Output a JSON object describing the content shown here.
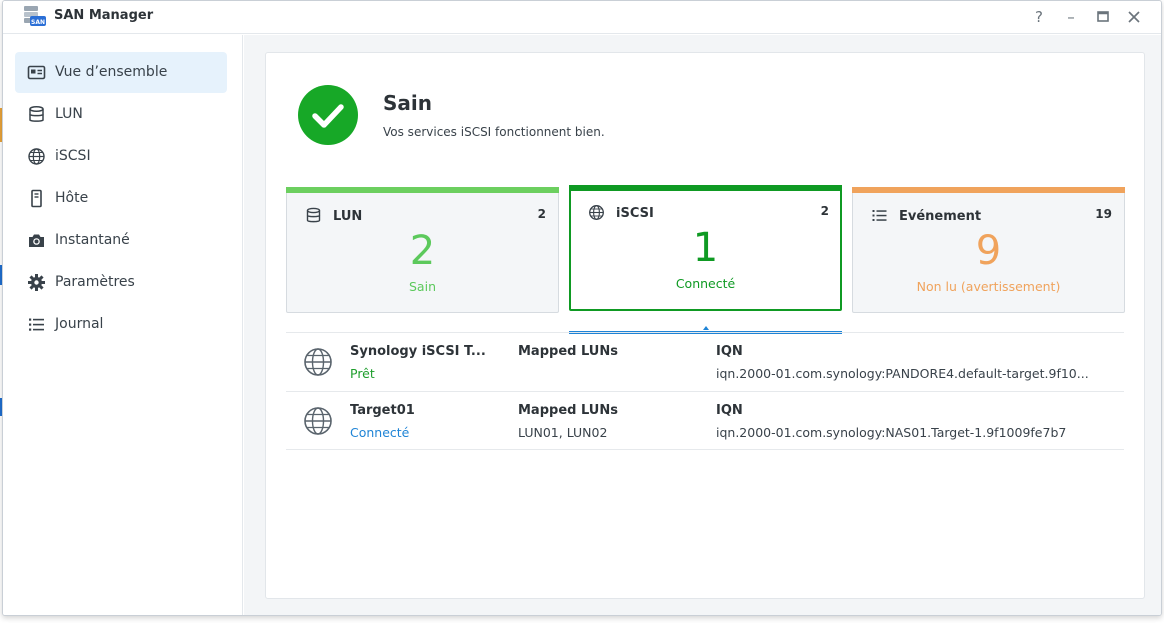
{
  "window": {
    "title": "SAN Manager",
    "controls": {
      "help": "?",
      "minimize": "–",
      "maximize": "□",
      "close": "×"
    }
  },
  "sidebar": {
    "items": [
      {
        "label": "Vue d’ensemble",
        "icon": "overview-icon",
        "active": true
      },
      {
        "label": "LUN",
        "icon": "database-icon"
      },
      {
        "label": "iSCSI",
        "icon": "globe-icon"
      },
      {
        "label": "Hôte",
        "icon": "host-icon"
      },
      {
        "label": "Instantané",
        "icon": "camera-icon"
      },
      {
        "label": "Paramètres",
        "icon": "gear-icon"
      },
      {
        "label": "Journal",
        "icon": "list-icon"
      }
    ]
  },
  "health": {
    "title": "Sain",
    "description": "Vos services iSCSI fonctionnent bien.",
    "icon": "check-circle-icon",
    "color": "#17a827"
  },
  "cards": [
    {
      "label": "LUN",
      "count": "2",
      "big": "2",
      "status": "Sain",
      "color": "#5cc95c",
      "icon": "database-icon"
    },
    {
      "label": "iSCSI",
      "count": "2",
      "big": "1",
      "status": "Connecté",
      "color": "#0f9a23",
      "icon": "globe-icon",
      "selected": true
    },
    {
      "label": "Evénement",
      "count": "19",
      "big": "9",
      "status": "Non lu (avertissement)",
      "color": "#f0a35c",
      "icon": "list-icon"
    }
  ],
  "targets": {
    "col_luns": "Mapped LUNs",
    "col_iqn": "IQN",
    "rows": [
      {
        "name": "Synology iSCSI T...",
        "status": "Prêt",
        "status_color": "#1f9e2d",
        "luns": "",
        "iqn": "iqn.2000-01.com.synology:PANDORE4.default-target.9f10..."
      },
      {
        "name": "Target01",
        "status": "Connecté",
        "status_color": "#1f84d6",
        "luns": "LUN01, LUN02",
        "iqn": "iqn.2000-01.com.synology:NAS01.Target-1.9f1009fe7b7"
      }
    ]
  },
  "colors": {
    "accent": "#1f84d6",
    "sidebar_active": "#e6f2fc"
  }
}
